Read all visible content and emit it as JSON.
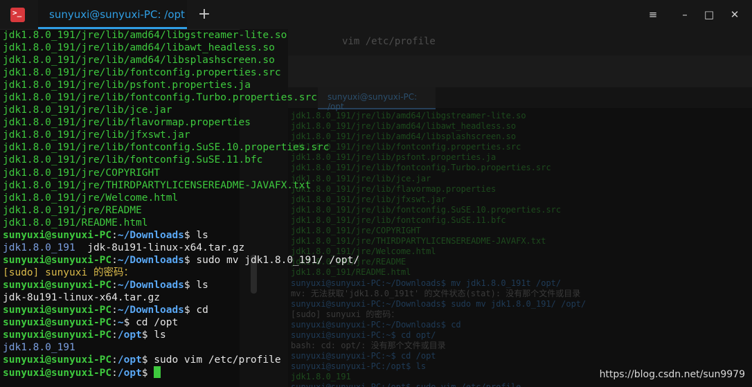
{
  "window": {
    "tab_title": "sunyuxi@sunyuxi-PC: /opt",
    "new_tab_symbol": "+",
    "menu_symbol": "≡",
    "minimize_symbol": "–",
    "maximize_symbol": "□",
    "close_symbol": "✕",
    "app_icon_symbol": ">_"
  },
  "background_window": {
    "command": "vim /etc/profile",
    "tab_title": "sunyuxi@sunyuxi-PC: /opt",
    "lines": [
      "jdk1.8.0_191/jre/lib/amd64/libgstreamer-lite.so",
      "jdk1.8.0_191/jre/lib/amd64/libawt_headless.so",
      "jdk1.8.0_191/jre/lib/amd64/libsplashscreen.so",
      "jdk1.8.0_191/jre/lib/fontconfig.properties.src",
      "jdk1.8.0_191/jre/lib/psfont.properties.ja",
      "jdk1.8.0_191/jre/lib/fontconfig.Turbo.properties.src",
      "jdk1.8.0_191/jre/lib/jce.jar",
      "jdk1.8.0_191/jre/lib/flavormap.properties",
      "jdk1.8.0_191/jre/lib/jfxswt.jar",
      "jdk1.8.0_191/jre/lib/fontconfig.SuSE.10.properties.src",
      "jdk1.8.0_191/jre/lib/fontconfig.SuSE.11.bfc",
      "jdk1.8.0_191/jre/COPYRIGHT",
      "jdk1.8.0_191/jre/THIRDPARTYLICENSEREADME-JAVAFX.txt",
      "jdk1.8.0_191/jre/Welcome.html",
      "jdk1.8.0_191/jre/README",
      "jdk1.8.0_191/README.html",
      "sunyuxi@sunyuxi-PC:~/Downloads$ mv jdk1.8.0_191t /opt/",
      "mv: 无法获取'jdk1.8.0_191t' 的文件状态(stat): 没有那个文件或目录",
      "sunyuxi@sunyuxi-PC:~/Downloads$ sudo mv jdk1.8.0_191/ /opt/",
      "[sudo] sunyuxi 的密码：",
      "sunyuxi@sunyuxi-PC:~/Downloads$ cd",
      "sunyuxi@sunyuxi-PC:~$ cd opt/",
      "bash: cd: opt/: 没有那个文件或目录",
      "sunyuxi@sunyuxi-PC:~$ cd /opt",
      "sunyuxi@sunyuxi-PC:/opt$ ls",
      "jdk1.8.0_191",
      "sunyuxi@sunyuxi-PC:/opt$ sudo vim /etc/profile"
    ]
  },
  "terminal": {
    "output_lines": [
      "jdk1.8.0_191/jre/lib/amd64/libgstreamer-lite.so",
      "jdk1.8.0_191/jre/lib/amd64/libawt_headless.so",
      "jdk1.8.0_191/jre/lib/amd64/libsplashscreen.so",
      "jdk1.8.0_191/jre/lib/fontconfig.properties.src",
      "jdk1.8.0_191/jre/lib/psfont.properties.ja",
      "jdk1.8.0_191/jre/lib/fontconfig.Turbo.properties.src",
      "jdk1.8.0_191/jre/lib/jce.jar",
      "jdk1.8.0_191/jre/lib/flavormap.properties",
      "jdk1.8.0_191/jre/lib/jfxswt.jar",
      "jdk1.8.0_191/jre/lib/fontconfig.SuSE.10.properties.src",
      "jdk1.8.0_191/jre/lib/fontconfig.SuSE.11.bfc",
      "jdk1.8.0_191/jre/COPYRIGHT",
      "jdk1.8.0_191/jre/THIRDPARTYLICENSEREADME-JAVAFX.txt",
      "jdk1.8.0_191/jre/Welcome.html",
      "jdk1.8.0_191/jre/README",
      "jdk1.8.0_191/README.html"
    ],
    "user_host": "sunyuxi@sunyuxi-PC",
    "sep": ":",
    "dollar": "$",
    "session": [
      {
        "kind": "prompt",
        "path": "~/Downloads",
        "cmd": " ls"
      },
      {
        "kind": "ls",
        "dir": "jdk1.8.0_191",
        "file": "  jdk-8u191-linux-x64.tar.gz"
      },
      {
        "kind": "prompt",
        "path": "~/Downloads",
        "cmd": " sudo mv jdk1.8.0_191/ /opt/"
      },
      {
        "kind": "plain",
        "text": "[sudo] sunyuxi 的密码："
      },
      {
        "kind": "prompt",
        "path": "~/Downloads",
        "cmd": " ls"
      },
      {
        "kind": "file",
        "text": "jdk-8u191-linux-x64.tar.gz"
      },
      {
        "kind": "prompt",
        "path": "~/Downloads",
        "cmd": " cd"
      },
      {
        "kind": "prompt",
        "path": "~",
        "cmd": " cd /opt"
      },
      {
        "kind": "prompt",
        "path": "/opt",
        "cmd": " ls"
      },
      {
        "kind": "dir",
        "text": "jdk1.8.0_191"
      },
      {
        "kind": "prompt",
        "path": "/opt",
        "cmd": " sudo vim /etc/profile"
      },
      {
        "kind": "prompt",
        "path": "/opt",
        "cmd": " ",
        "cursor": true
      }
    ]
  },
  "watermark": "https://blog.csdn.net/sun9979",
  "colors": {
    "accent": "#2f9ee4",
    "output_green": "#3ec93e",
    "path_blue": "#5aa8f5",
    "background": "#0d0d0d"
  }
}
